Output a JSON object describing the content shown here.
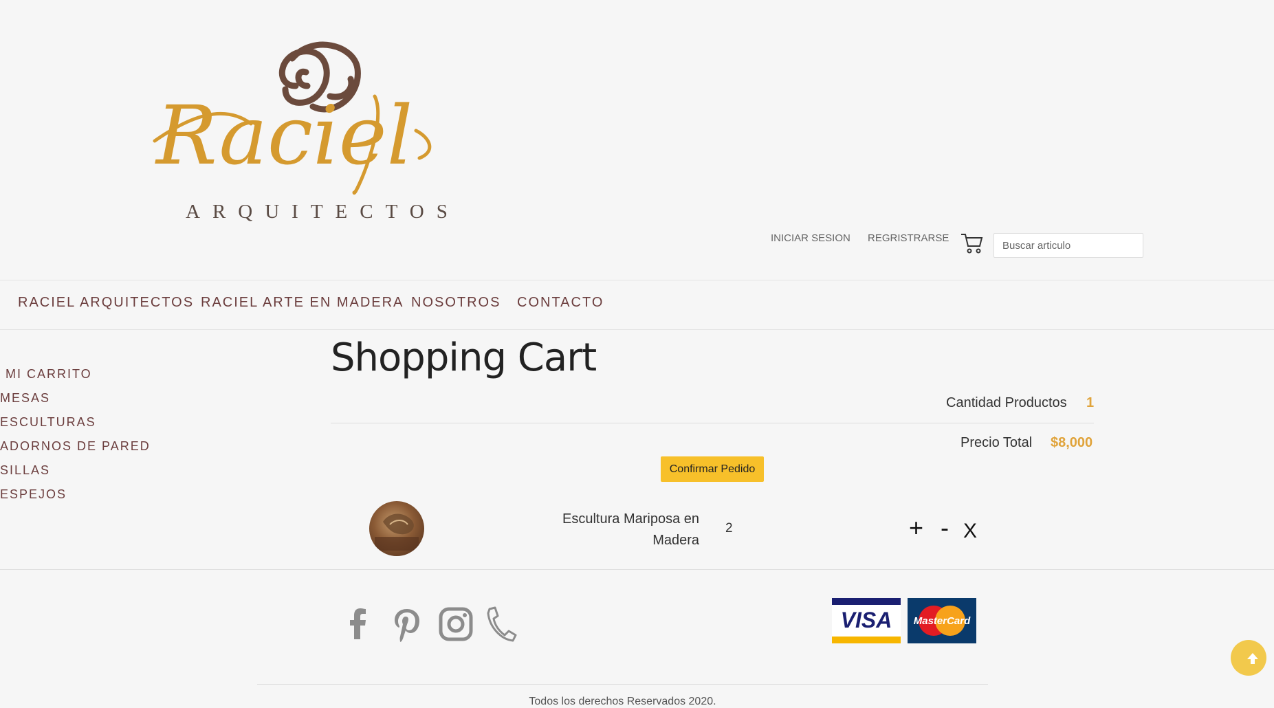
{
  "brand": {
    "logo_text": "Raciel",
    "logo_subtitle": "ARQUITECTOS"
  },
  "header": {
    "login": "INICIAR SESION",
    "register": "REGRISTRARSE",
    "search_placeholder": "Buscar articulo"
  },
  "nav": {
    "items": [
      "RACIEL ARQUITECTOS",
      "RACIEL ARTE EN MADERA",
      "NOSOTROS",
      "CONTACTO"
    ]
  },
  "sidebar": {
    "items": [
      "MI CARRITO",
      "MESAS",
      "ESCULTURAS",
      "ADORNOS DE PARED",
      "SILLAS",
      "ESPEJOS"
    ]
  },
  "cart": {
    "title": "Shopping Cart",
    "qty_label": "Cantidad Productos",
    "qty_value": "1",
    "total_label": "Precio Total",
    "total_value": "$8,000",
    "confirm_label": "Confirmar Pedido",
    "item": {
      "name": "Escultura Mariposa en Madera",
      "quantity": "2",
      "plus": "+",
      "minus": "-",
      "remove": "X"
    }
  },
  "footer": {
    "cards": [
      "VISA",
      "MasterCard"
    ],
    "copyright": "Todos los derechos Reservados 2020."
  },
  "colors": {
    "accent": "#e0a33a",
    "nav_text": "#6b3d3d",
    "confirm_bg": "#f7c02a",
    "logo_gold": "#d59a2f",
    "logo_brown": "#6b4a3c"
  }
}
